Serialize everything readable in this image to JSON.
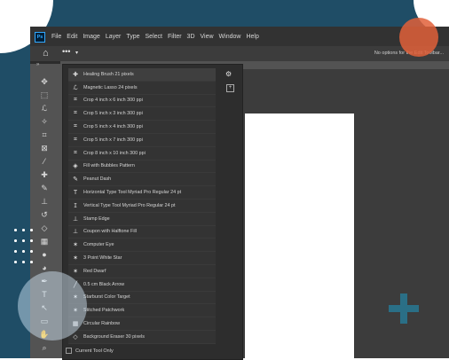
{
  "menu": [
    "File",
    "Edit",
    "Image",
    "Layer",
    "Type",
    "Select",
    "Filter",
    "3D",
    "View",
    "Window",
    "Help"
  ],
  "app_logo": "Ps",
  "options_hint": "No options for the Edit Toolbar...",
  "tool_presets": [
    {
      "icon": "healing-brush-icon",
      "label": "Healing Brush 21 pixels"
    },
    {
      "icon": "magnetic-lasso-icon",
      "label": "Magnetic Lasso 24 pixels"
    },
    {
      "icon": "crop-icon",
      "label": "Crop 4 inch x 6 inch 300 ppi"
    },
    {
      "icon": "crop-icon",
      "label": "Crop 5 inch x 3 inch 300 ppi"
    },
    {
      "icon": "crop-icon",
      "label": "Crop 5 inch x 4 inch 300 ppi"
    },
    {
      "icon": "crop-icon",
      "label": "Crop 5 inch x 7 inch 300 ppi"
    },
    {
      "icon": "crop-icon",
      "label": "Crop 8 inch x 10 inch 300 ppi"
    },
    {
      "icon": "paint-bucket-icon",
      "label": "Fill with Bubbles Pattern"
    },
    {
      "icon": "brush-icon",
      "label": "Peanut Dash"
    },
    {
      "icon": "type-icon",
      "label": "Horizontal Type Tool Myriad Pro Regular 24 pt"
    },
    {
      "icon": "vertical-type-icon",
      "label": "Vertical Type Tool Myriad Pro Regular 24 pt"
    },
    {
      "icon": "stamp-icon",
      "label": "Stamp Edge"
    },
    {
      "icon": "stamp-icon",
      "label": "Coupon with Halftone Fill"
    },
    {
      "icon": "shape-icon",
      "label": "Computer Eye"
    },
    {
      "icon": "shape-icon",
      "label": "3 Point White Star"
    },
    {
      "icon": "shape-icon",
      "label": "Red Dwarf"
    },
    {
      "icon": "line-icon",
      "label": "0.5 cm Black Arrow"
    },
    {
      "icon": "shape-icon",
      "label": "Starburst Color Target"
    },
    {
      "icon": "shape-icon",
      "label": "Stitched Patchwork"
    },
    {
      "icon": "gradient-icon",
      "label": "Circular Rainbow"
    },
    {
      "icon": "eraser-icon",
      "label": "Background Eraser 30 pixels"
    }
  ],
  "footer": {
    "checkbox_label": "Current Tool Only"
  },
  "colors": {
    "accent_orange": "#e0603a",
    "teal": "#1f4d66",
    "plus_teal": "#2a6f86"
  }
}
